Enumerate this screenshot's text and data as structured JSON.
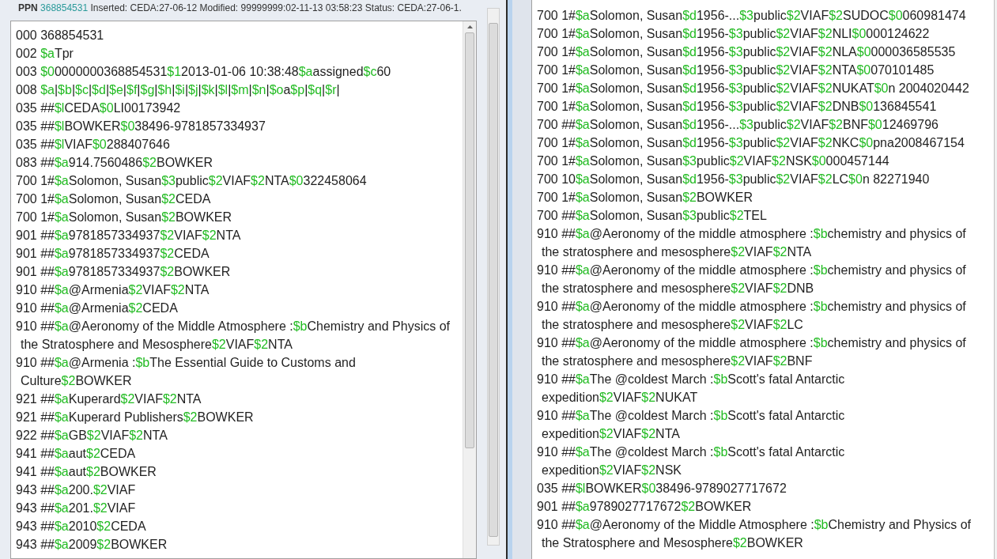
{
  "header": {
    "label": "PPN",
    "ppn": "368854531",
    "info": "Inserted: CEDA:27-06-12 Modified: 99999999:02-11-13 03:58:23 Status: CEDA:27-06-1."
  },
  "left_record": [
    {
      "tag": "000 368854531"
    },
    {
      "tag": "002 ",
      "fields": [
        [
          "$a",
          "Tpr"
        ]
      ]
    },
    {
      "tag": "003 ",
      "fields": [
        [
          "$0",
          "0000000368854531"
        ],
        [
          "$1",
          "2013-01-06 10:38:48"
        ],
        [
          "$a",
          "assigned"
        ],
        [
          "$c",
          "60"
        ]
      ]
    },
    {
      "tag": "008 ",
      "fields": [
        [
          "$a",
          "|"
        ],
        [
          "$b",
          "|"
        ],
        [
          "$c",
          "|"
        ],
        [
          "$d",
          "|"
        ],
        [
          "$e",
          "|"
        ],
        [
          "$f",
          "|"
        ],
        [
          "$g",
          "|"
        ],
        [
          "$h",
          "|"
        ],
        [
          "$i",
          "|"
        ],
        [
          "$j",
          "|"
        ],
        [
          "$k",
          "|"
        ],
        [
          "$l",
          "|"
        ],
        [
          "$m",
          "|"
        ],
        [
          "$n",
          "|"
        ],
        [
          "$o",
          "a"
        ],
        [
          "$p",
          "|"
        ],
        [
          "$q",
          "|"
        ],
        [
          "$r",
          "|"
        ]
      ]
    },
    {
      "tag": "035 ##",
      "fields": [
        [
          "$l",
          "CEDA"
        ],
        [
          "$0",
          "LI00173942"
        ]
      ]
    },
    {
      "tag": "035 ##",
      "fields": [
        [
          "$l",
          "BOWKER"
        ],
        [
          "$0",
          "38496-9781857334937"
        ]
      ]
    },
    {
      "tag": "035 ##",
      "fields": [
        [
          "$l",
          "VIAF"
        ],
        [
          "$0",
          "288407646"
        ]
      ]
    },
    {
      "tag": "083 ##",
      "fields": [
        [
          "$a",
          "914.7560486"
        ],
        [
          "$2",
          "BOWKER"
        ]
      ]
    },
    {
      "tag": "700 1#",
      "fields": [
        [
          "$a",
          "Solomon, Susan"
        ],
        [
          "$3",
          "public"
        ],
        [
          "$2",
          "VIAF"
        ],
        [
          "$2",
          "NTA"
        ],
        [
          "$0",
          "322458064"
        ]
      ]
    },
    {
      "tag": "700 1#",
      "fields": [
        [
          "$a",
          "Solomon, Susan"
        ],
        [
          "$2",
          "CEDA"
        ]
      ]
    },
    {
      "tag": "700 1#",
      "fields": [
        [
          "$a",
          "Solomon, Susan"
        ],
        [
          "$2",
          "BOWKER"
        ]
      ]
    },
    {
      "tag": "901 ##",
      "fields": [
        [
          "$a",
          "9781857334937"
        ],
        [
          "$2",
          "VIAF"
        ],
        [
          "$2",
          "NTA"
        ]
      ]
    },
    {
      "tag": "901 ##",
      "fields": [
        [
          "$a",
          "9781857334937"
        ],
        [
          "$2",
          "CEDA"
        ]
      ]
    },
    {
      "tag": "901 ##",
      "fields": [
        [
          "$a",
          "9781857334937"
        ],
        [
          "$2",
          "BOWKER"
        ]
      ]
    },
    {
      "tag": "910 ##",
      "fields": [
        [
          "$a",
          "@Armenia"
        ],
        [
          "$2",
          "VIAF"
        ],
        [
          "$2",
          "NTA"
        ]
      ]
    },
    {
      "tag": "910 ##",
      "fields": [
        [
          "$a",
          "@Armenia"
        ],
        [
          "$2",
          "CEDA"
        ]
      ]
    },
    {
      "tag": "910 ##",
      "fields": [
        [
          "$a",
          "@Aeronomy of the Middle Atmosphere :"
        ],
        [
          "$b",
          "Chemistry and Physics of the Stratosphere and Mesosphere"
        ],
        [
          "$2",
          "VIAF"
        ],
        [
          "$2",
          "NTA"
        ]
      ]
    },
    {
      "tag": "910 ##",
      "fields": [
        [
          "$a",
          "@Armenia :"
        ],
        [
          "$b",
          "The Essential Guide to Customs and Culture"
        ],
        [
          "$2",
          "BOWKER"
        ]
      ]
    },
    {
      "tag": "921 ##",
      "fields": [
        [
          "$a",
          "Kuperard"
        ],
        [
          "$2",
          "VIAF"
        ],
        [
          "$2",
          "NTA"
        ]
      ]
    },
    {
      "tag": "921 ##",
      "fields": [
        [
          "$a",
          "Kuperard Publishers"
        ],
        [
          "$2",
          "BOWKER"
        ]
      ]
    },
    {
      "tag": "922 ##",
      "fields": [
        [
          "$a",
          "GB"
        ],
        [
          "$2",
          "VIAF"
        ],
        [
          "$2",
          "NTA"
        ]
      ]
    },
    {
      "tag": "941 ##",
      "fields": [
        [
          "$a",
          "aut"
        ],
        [
          "$2",
          "CEDA"
        ]
      ]
    },
    {
      "tag": "941 ##",
      "fields": [
        [
          "$a",
          "aut"
        ],
        [
          "$2",
          "BOWKER"
        ]
      ]
    },
    {
      "tag": "943 ##",
      "fields": [
        [
          "$a",
          "200."
        ],
        [
          "$2",
          "VIAF"
        ]
      ]
    },
    {
      "tag": "943 ##",
      "fields": [
        [
          "$a",
          "201."
        ],
        [
          "$2",
          "VIAF"
        ]
      ]
    },
    {
      "tag": "943 ##",
      "fields": [
        [
          "$a",
          "2010"
        ],
        [
          "$2",
          "CEDA"
        ]
      ]
    },
    {
      "tag": "943 ##",
      "fields": [
        [
          "$a",
          "2009"
        ],
        [
          "$2",
          "BOWKER"
        ]
      ]
    }
  ],
  "right_record": [
    {
      "tag": "700 1#",
      "fields": [
        [
          "$a",
          "Solomon, Susan"
        ],
        [
          "$d",
          "1956-..."
        ],
        [
          "$3",
          "public"
        ],
        [
          "$2",
          "VIAF"
        ],
        [
          "$2",
          "SUDOC"
        ],
        [
          "$0",
          "060981474"
        ]
      ]
    },
    {
      "tag": "700 1#",
      "fields": [
        [
          "$a",
          "Solomon, Susan"
        ],
        [
          "$d",
          "1956-"
        ],
        [
          "$3",
          "public"
        ],
        [
          "$2",
          "VIAF"
        ],
        [
          "$2",
          "NLI"
        ],
        [
          "$0",
          "000124622"
        ]
      ]
    },
    {
      "tag": "700 1#",
      "fields": [
        [
          "$a",
          "Solomon, Susan"
        ],
        [
          "$d",
          "1956-"
        ],
        [
          "$3",
          "public"
        ],
        [
          "$2",
          "VIAF"
        ],
        [
          "$2",
          "NLA"
        ],
        [
          "$0",
          "000036585535"
        ]
      ]
    },
    {
      "tag": "700 1#",
      "fields": [
        [
          "$a",
          "Solomon, Susan"
        ],
        [
          "$d",
          "1956-"
        ],
        [
          "$3",
          "public"
        ],
        [
          "$2",
          "VIAF"
        ],
        [
          "$2",
          "NTA"
        ],
        [
          "$0",
          "070101485"
        ]
      ]
    },
    {
      "tag": "700 1#",
      "fields": [
        [
          "$a",
          "Solomon, Susan"
        ],
        [
          "$d",
          "1956-"
        ],
        [
          "$3",
          "public"
        ],
        [
          "$2",
          "VIAF"
        ],
        [
          "$2",
          "NUKAT"
        ],
        [
          "$0",
          "n 2004020442"
        ]
      ]
    },
    {
      "tag": "700 1#",
      "fields": [
        [
          "$a",
          "Solomon, Susan"
        ],
        [
          "$d",
          "1956-"
        ],
        [
          "$3",
          "public"
        ],
        [
          "$2",
          "VIAF"
        ],
        [
          "$2",
          "DNB"
        ],
        [
          "$0",
          "136845541"
        ]
      ]
    },
    {
      "tag": "700 ##",
      "fields": [
        [
          "$a",
          "Solomon, Susan"
        ],
        [
          "$d",
          "1956-..."
        ],
        [
          "$3",
          "public"
        ],
        [
          "$2",
          "VIAF"
        ],
        [
          "$2",
          "BNF"
        ],
        [
          "$0",
          "12469796"
        ]
      ]
    },
    {
      "tag": "700 1#",
      "fields": [
        [
          "$a",
          "Solomon, Susan"
        ],
        [
          "$d",
          "1956-"
        ],
        [
          "$3",
          "public"
        ],
        [
          "$2",
          "VIAF"
        ],
        [
          "$2",
          "NKC"
        ],
        [
          "$0",
          "pna2008467154"
        ]
      ]
    },
    {
      "tag": "700 1#",
      "fields": [
        [
          "$a",
          "Solomon, Susan"
        ],
        [
          "$3",
          "public"
        ],
        [
          "$2",
          "VIAF"
        ],
        [
          "$2",
          "NSK"
        ],
        [
          "$0",
          "000457144"
        ]
      ]
    },
    {
      "tag": "700 10",
      "fields": [
        [
          "$a",
          "Solomon, Susan"
        ],
        [
          "$d",
          "1956-"
        ],
        [
          "$3",
          "public"
        ],
        [
          "$2",
          "VIAF"
        ],
        [
          "$2",
          "LC"
        ],
        [
          "$0",
          "n  82271940"
        ]
      ]
    },
    {
      "tag": "700 1#",
      "fields": [
        [
          "$a",
          "Solomon, Susan"
        ],
        [
          "$2",
          "BOWKER"
        ]
      ]
    },
    {
      "tag": "700 ##",
      "fields": [
        [
          "$a",
          "Solomon, Susan"
        ],
        [
          "$3",
          "public"
        ],
        [
          "$2",
          "TEL"
        ]
      ]
    },
    {
      "tag": "910 ##",
      "fields": [
        [
          "$a",
          "@Aeronomy of the middle atmosphere :"
        ],
        [
          "$b",
          "chemistry and physics of the stratosphere and mesosphere"
        ],
        [
          "$2",
          "VIAF"
        ],
        [
          "$2",
          "NTA"
        ]
      ]
    },
    {
      "tag": "910 ##",
      "fields": [
        [
          "$a",
          "@Aeronomy of the middle atmosphere :"
        ],
        [
          "$b",
          "chemistry and physics of the stratosphere and mesosphere"
        ],
        [
          "$2",
          "VIAF"
        ],
        [
          "$2",
          "DNB"
        ]
      ]
    },
    {
      "tag": "910 ##",
      "fields": [
        [
          "$a",
          "@Aeronomy of the middle atmosphere :"
        ],
        [
          "$b",
          "chemistry and physics of the stratosphere and mesosphere"
        ],
        [
          "$2",
          "VIAF"
        ],
        [
          "$2",
          "LC"
        ]
      ]
    },
    {
      "tag": "910 ##",
      "fields": [
        [
          "$a",
          "@Aeronomy of the middle atmosphere :"
        ],
        [
          "$b",
          "chemistry and physics of the stratosphere and mesosphere"
        ],
        [
          "$2",
          "VIAF"
        ],
        [
          "$2",
          "BNF"
        ]
      ]
    },
    {
      "tag": "910 ##",
      "fields": [
        [
          "$a",
          "The @coldest March :"
        ],
        [
          "$b",
          "Scott's fatal Antarctic expedition"
        ],
        [
          "$2",
          "VIAF"
        ],
        [
          "$2",
          "NUKAT"
        ]
      ]
    },
    {
      "tag": "910 ##",
      "fields": [
        [
          "$a",
          "The @coldest March :"
        ],
        [
          "$b",
          "Scott's fatal Antarctic expedition"
        ],
        [
          "$2",
          "VIAF"
        ],
        [
          "$2",
          "NTA"
        ]
      ]
    },
    {
      "tag": "910 ##",
      "fields": [
        [
          "$a",
          "The @coldest March :"
        ],
        [
          "$b",
          "Scott's fatal Antarctic expedition"
        ],
        [
          "$2",
          "VIAF"
        ],
        [
          "$2",
          "NSK"
        ]
      ]
    },
    {
      "tag": "035 ##",
      "fields": [
        [
          "$l",
          "BOWKER"
        ],
        [
          "$0",
          "38496-9789027717672"
        ]
      ]
    },
    {
      "tag": "901 ##",
      "fields": [
        [
          "$a",
          "9789027717672"
        ],
        [
          "$2",
          "BOWKER"
        ]
      ]
    },
    {
      "tag": "910 ##",
      "fields": [
        [
          "$a",
          "@Aeronomy of the Middle Atmosphere :"
        ],
        [
          "$b",
          "Chemistry and Physics of the Stratosphere and Mesosphere"
        ],
        [
          "$2",
          "BOWKER"
        ]
      ]
    }
  ]
}
